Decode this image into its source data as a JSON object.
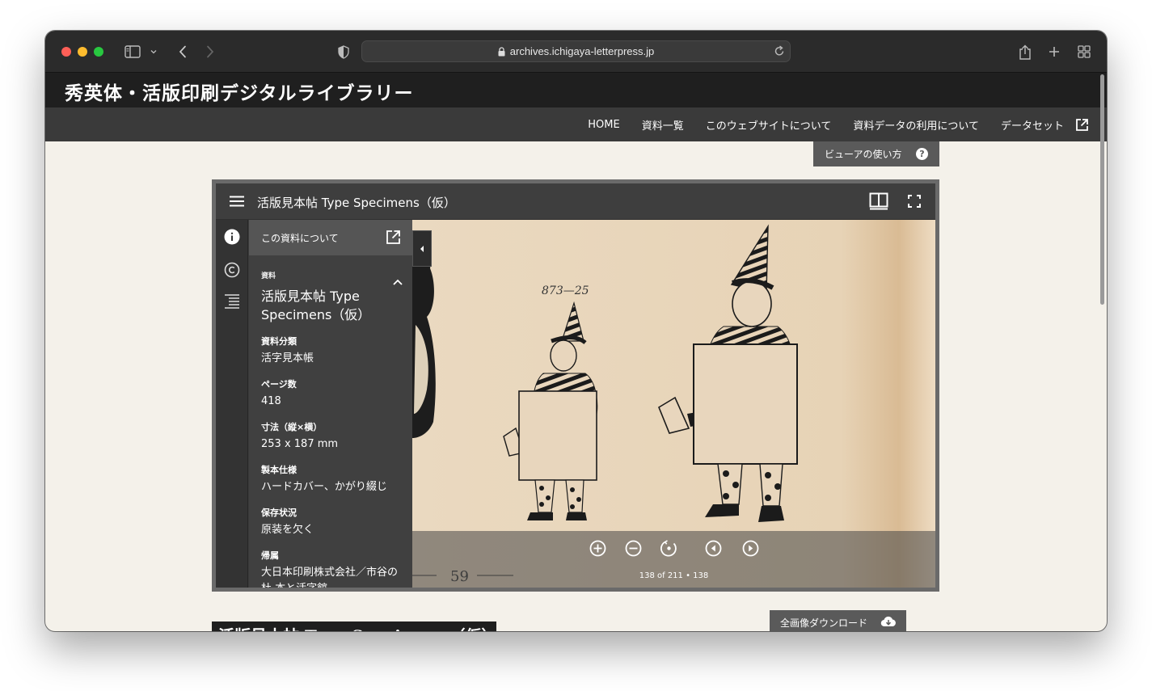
{
  "browser": {
    "url": "archives.ichigaya-letterpress.jp"
  },
  "site": {
    "title": "秀英体・活版印刷デジタルライブラリー",
    "nav": [
      {
        "label": "HOME"
      },
      {
        "label": "資料一覧"
      },
      {
        "label": "このウェブサイトについて"
      },
      {
        "label": "資料データの利用について"
      },
      {
        "label": "データセット"
      }
    ],
    "help_button": "ビューアの使い方",
    "help_icon": "?",
    "download_button": "全画像ダウンロード",
    "bottom_heading": "活版見本帖 Type Specimens（仮）"
  },
  "viewer": {
    "title": "活版見本帖 Type Specimens（仮）",
    "panel": {
      "header": "この資料について",
      "section_label": "資料",
      "item_title": "活版見本帖 Type Specimens（仮）",
      "fields": [
        {
          "label": "資料分類",
          "value": "活字見本帳"
        },
        {
          "label": "ページ数",
          "value": "418"
        },
        {
          "label": "寸法（縦×横）",
          "value": "253 x 187 mm"
        },
        {
          "label": "製本仕様",
          "value": "ハードカバー、かがり綴じ"
        },
        {
          "label": "保存状況",
          "value": "原装を欠く"
        },
        {
          "label": "帰属",
          "value": "大日本印刷株式会社／市谷の杜 本と活字館"
        }
      ]
    },
    "image": {
      "specimen_number": "873—25",
      "page_number": "59"
    },
    "page_info": "138 of 211 • 138"
  },
  "colors": {
    "chrome": "#2b2b2b",
    "site_header": "#1f1f1f",
    "nav_bar": "#3a3a3a",
    "page_bg": "#f4f1ea",
    "viewer_bg": "#3b3b3b",
    "paper": "#e8d6bd"
  }
}
